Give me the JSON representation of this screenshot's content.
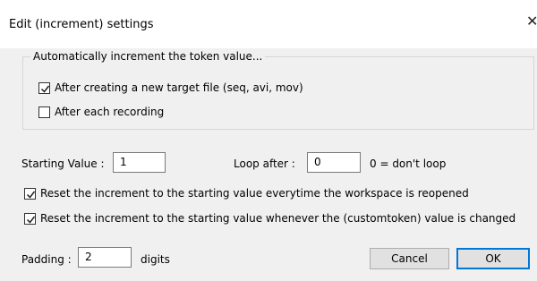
{
  "dialog": {
    "title": "Edit (increment) settings",
    "close_glyph": "✕"
  },
  "auto_increment": {
    "legend": "Automatically increment the token value...",
    "options": [
      {
        "label": "After creating a new target file (seq, avi, mov)",
        "checked": true
      },
      {
        "label": "After each recording",
        "checked": false
      }
    ]
  },
  "values": {
    "starting_label": "Starting Value :",
    "starting_value": "1",
    "loop_label": "Loop after :",
    "loop_value": "0",
    "loop_hint": "0 = don't loop"
  },
  "reset_options": [
    {
      "label": "Reset the increment to the starting value everytime the workspace is reopened",
      "checked": true
    },
    {
      "label": "Reset the increment to the starting value whenever the (customtoken) value is changed",
      "checked": true
    }
  ],
  "padding": {
    "label": "Padding :",
    "value": "2",
    "unit": "digits"
  },
  "buttons": {
    "cancel": "Cancel",
    "ok": "OK"
  }
}
